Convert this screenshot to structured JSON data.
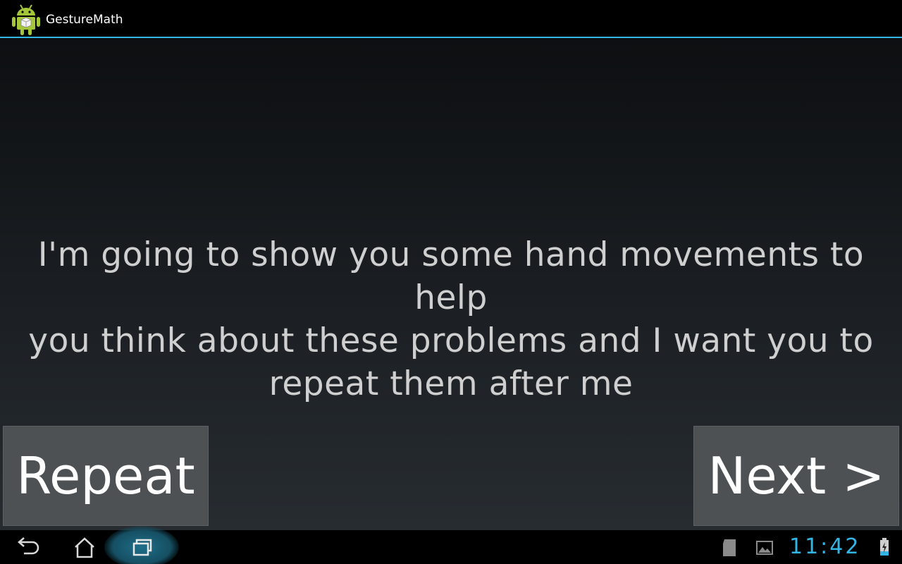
{
  "action_bar": {
    "app_title": "GestureMath",
    "app_icon": "android-robot-icon",
    "accent_color": "#33b5e5"
  },
  "content": {
    "message_line1": "I'm going to show you some hand movements to help",
    "message_line2": "you think about these problems and I want you to",
    "message_line3": "repeat them after me"
  },
  "buttons": {
    "repeat_label": "Repeat",
    "next_label": "Next >"
  },
  "system_bar": {
    "clock": "11:42",
    "nav_icons": [
      "back-icon",
      "home-icon",
      "recent-apps-icon"
    ],
    "status_icons": [
      "sd-card-icon",
      "gallery-icon",
      "battery-charging-icon"
    ]
  }
}
